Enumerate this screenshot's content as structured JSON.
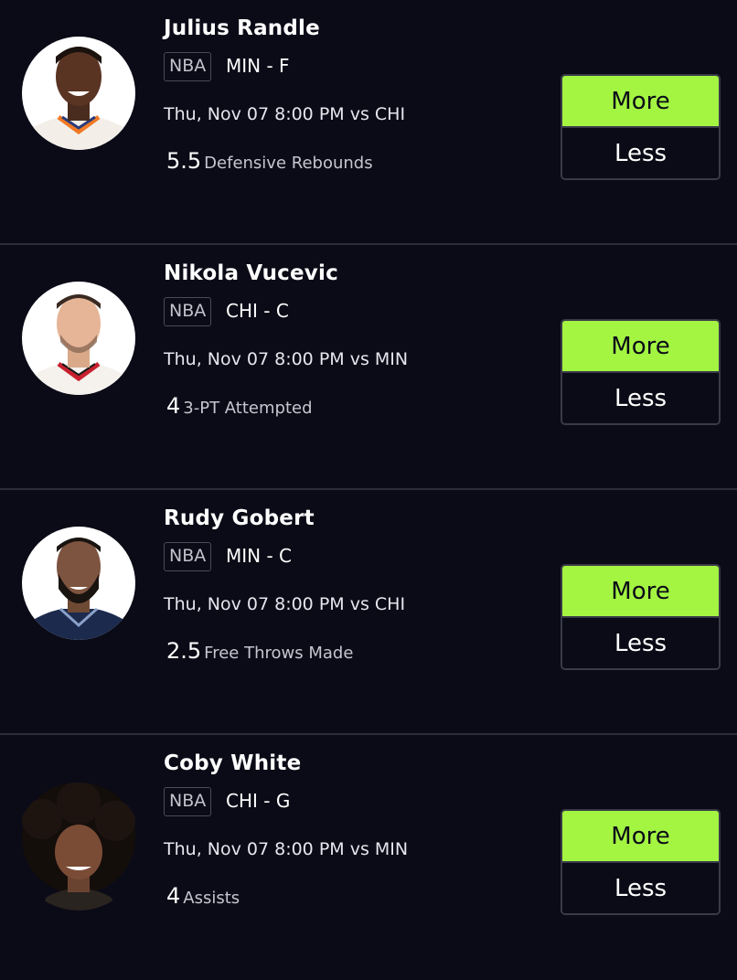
{
  "colors": {
    "background": "#0b0b17",
    "accent": "#a3f542",
    "divider": "#2c2c3a"
  },
  "picks": [
    {
      "name": "Julius Randle",
      "league": "NBA",
      "team_position": "MIN - F",
      "game": "Thu, Nov 07 8:00 PM vs CHI",
      "line": "5.5",
      "stat": "Defensive Rebounds",
      "more_label": "More",
      "less_label": "Less"
    },
    {
      "name": "Nikola Vucevic",
      "league": "NBA",
      "team_position": "CHI - C",
      "game": "Thu, Nov 07 8:00 PM vs MIN",
      "line": "4",
      "stat": "3-PT Attempted",
      "more_label": "More",
      "less_label": "Less"
    },
    {
      "name": "Rudy Gobert",
      "league": "NBA",
      "team_position": "MIN - C",
      "game": "Thu, Nov 07 8:00 PM vs CHI",
      "line": "2.5",
      "stat": "Free Throws Made",
      "more_label": "More",
      "less_label": "Less"
    },
    {
      "name": "Coby White",
      "league": "NBA",
      "team_position": "CHI - G",
      "game": "Thu, Nov 07 8:00 PM vs MIN",
      "line": "4",
      "stat": "Assists",
      "more_label": "More",
      "less_label": "Less"
    }
  ]
}
